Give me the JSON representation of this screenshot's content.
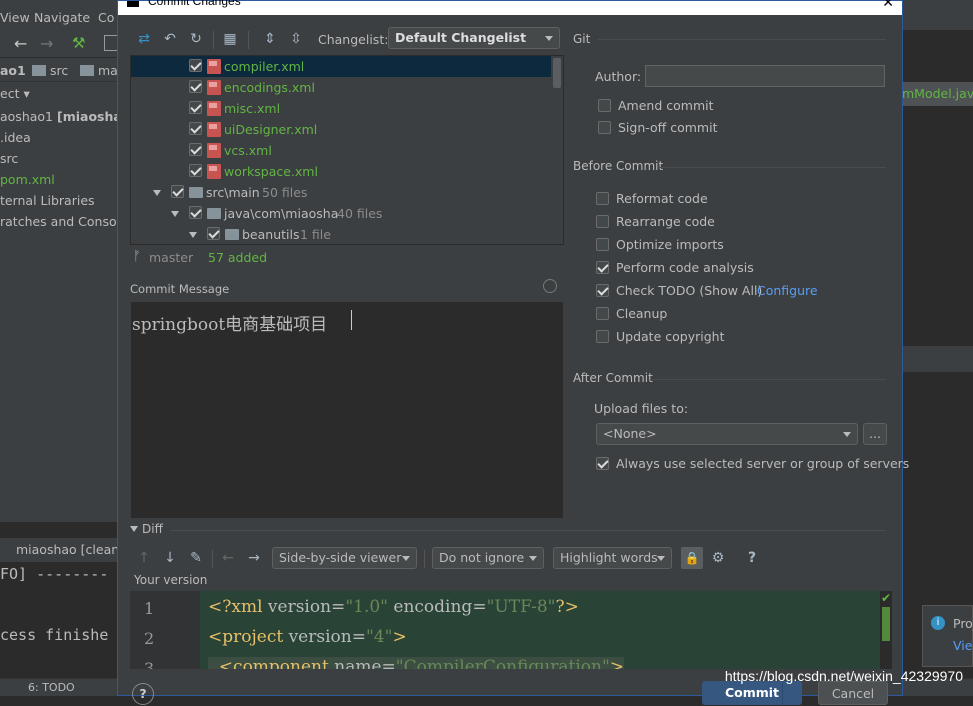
{
  "ide": {
    "menu": [
      "View",
      "Navigate",
      "Co"
    ],
    "breadcrumbs": [
      "ao1",
      "src",
      "ma"
    ],
    "project_header": "ect",
    "project_items": [
      {
        "label": "aoshao1 ",
        "bold": "[miaosha]"
      },
      {
        "label": ".idea"
      },
      {
        "label": "src"
      },
      {
        "label": "pom.xml"
      },
      {
        "label": "ternal Libraries"
      },
      {
        "label": "ratches and Console"
      }
    ],
    "run_title": "miaoshao [clean]",
    "run_lines": [
      "FO] --------",
      "cess finishe"
    ],
    "status_tab": "6: TODO",
    "editor_tab": "mModel.java",
    "notification": [
      "Proj",
      "Vie"
    ],
    "watermark": "https://blog.csdn.net/weixin_42329970"
  },
  "dialog": {
    "title": "Commit Changes",
    "changelist_label": "Changelist:",
    "changelist_value": "Default Changelist",
    "files": [
      {
        "name": "compiler.xml",
        "type": "xml",
        "checked": true,
        "selected": true
      },
      {
        "name": "encodings.xml",
        "type": "xml",
        "checked": true
      },
      {
        "name": "misc.xml",
        "type": "xml",
        "checked": true
      },
      {
        "name": "uiDesigner.xml",
        "type": "xml",
        "checked": true
      },
      {
        "name": "vcs.xml",
        "type": "xml",
        "checked": true
      },
      {
        "name": "workspace.xml",
        "type": "xml",
        "checked": true
      },
      {
        "name": "src\\main",
        "count": "50 files",
        "type": "folder",
        "checked": true
      },
      {
        "name": "java\\com\\miaosha",
        "count": "40 files",
        "type": "folder",
        "checked": true
      },
      {
        "name": "beanutils",
        "count": "1 file",
        "type": "folder",
        "checked": true
      }
    ],
    "branch": "master",
    "added": "57 added",
    "commit_message_label": "Commit Message",
    "commit_message": "springboot电商基础项目",
    "git_section": "Git",
    "author_label": "Author:",
    "author_value": "",
    "git_options": [
      {
        "label": "Amend commit",
        "checked": false
      },
      {
        "label": "Sign-off commit",
        "checked": false
      }
    ],
    "before_commit_section": "Before Commit",
    "before_options": [
      {
        "label": "Reformat code",
        "checked": false
      },
      {
        "label": "Rearrange code",
        "checked": false
      },
      {
        "label": "Optimize imports",
        "checked": false
      },
      {
        "label": "Perform code analysis",
        "checked": true
      },
      {
        "label": "Check TODO (Show All)",
        "checked": true,
        "link": "Configure"
      },
      {
        "label": "Cleanup",
        "checked": false
      },
      {
        "label": "Update copyright",
        "checked": false
      }
    ],
    "after_commit_section": "After Commit",
    "upload_label": "Upload files to:",
    "upload_value": "<None>",
    "browse_label": "...",
    "always_use_label": "Always use selected server or group of servers",
    "always_use_checked": true,
    "diff_section": "Diff",
    "viewer": "Side-by-side viewer",
    "ignore": "Do not ignore",
    "highlight": "Highlight words",
    "help": "?",
    "your_version": "Your version",
    "code_lines": [
      {
        "num": "1",
        "parts": [
          [
            "tag",
            "<?xml "
          ],
          [
            "attr",
            "version="
          ],
          [
            "val",
            "\"1.0\""
          ],
          [
            "attr",
            " encoding="
          ],
          [
            "val",
            "\"UTF-8\""
          ],
          [
            "tag",
            "?>"
          ]
        ]
      },
      {
        "num": "2",
        "parts": [
          [
            "tag",
            "<project "
          ],
          [
            "attr",
            "version="
          ],
          [
            "val",
            "\"4\""
          ],
          [
            "tag",
            ">"
          ]
        ]
      },
      {
        "num": "3",
        "parts": [
          [
            "tag",
            "  <component "
          ],
          [
            "attr",
            "name="
          ],
          [
            "val",
            "\"CompilerConfiguration\""
          ],
          [
            "tag",
            ">"
          ]
        ]
      }
    ],
    "commit_button": "Commit",
    "cancel_button": "Cancel"
  }
}
